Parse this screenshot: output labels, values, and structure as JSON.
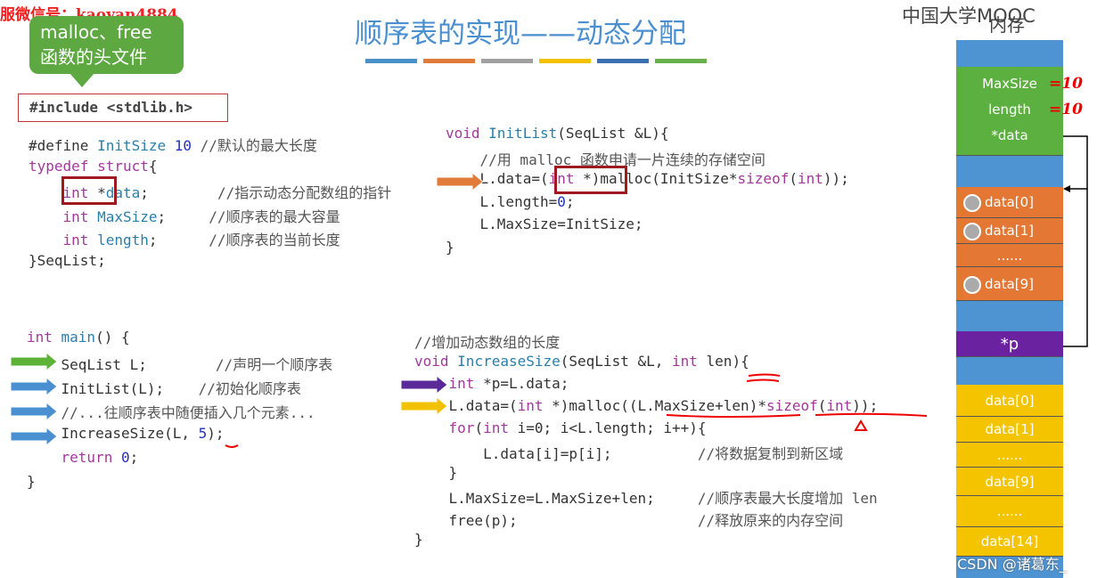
{
  "watermark": "服微信号：kaoyan4884",
  "title": "顺序表的实现——动态分配",
  "logo": "中国大学MOOC",
  "memory_label": "内存",
  "credit": "CSDN @诸葛东_",
  "callout": {
    "line1": "malloc、free",
    "line2": "函数的头文件"
  },
  "include": "#include <stdlib.h>",
  "title_bar_colors": [
    "#4a90c8",
    "#e07b39",
    "#a0a0a0",
    "#f2c200",
    "#3a6fb0",
    "#6ab04c"
  ],
  "code_struct": [
    [
      [
        "#define ",
        ""
      ],
      [
        "InitSize ",
        "id"
      ],
      [
        "10",
        "num"
      ],
      [
        " //默认的最大长度",
        "cm"
      ]
    ],
    [
      [
        "typedef struct",
        "kw"
      ],
      [
        "{",
        ""
      ]
    ],
    [
      [
        "    int ",
        "kw"
      ],
      [
        "*",
        ""
      ],
      [
        "data",
        "id"
      ],
      [
        ";        ",
        ""
      ],
      [
        "//指示动态分配数组的指针",
        "cm"
      ]
    ],
    [
      [
        "    int ",
        "kw"
      ],
      [
        "MaxSize",
        "id"
      ],
      [
        ";     ",
        ""
      ],
      [
        "//顺序表的最大容量",
        "cm"
      ]
    ],
    [
      [
        "    int ",
        "kw"
      ],
      [
        "length",
        "id"
      ],
      [
        ";      ",
        ""
      ],
      [
        "//顺序表的当前长度",
        "cm"
      ]
    ],
    [
      [
        "}SeqList;",
        ""
      ]
    ]
  ],
  "code_init": [
    [
      [
        "void ",
        "kw"
      ],
      [
        "InitList",
        "id"
      ],
      [
        "(SeqList &L){",
        ""
      ]
    ],
    [
      [
        "    //用 malloc 函数申请一片连续的存储空间",
        "cm"
      ]
    ],
    [
      [
        "    L.data=(",
        ""
      ],
      [
        "int",
        "kw"
      ],
      [
        " *)malloc(InitSize*",
        ""
      ],
      [
        "sizeof",
        "kw"
      ],
      [
        "(",
        ""
      ],
      [
        "int",
        "kw"
      ],
      [
        "));",
        ""
      ]
    ],
    [
      [
        "    L.length=",
        ""
      ],
      [
        "0",
        "num"
      ],
      [
        ";",
        ""
      ]
    ],
    [
      [
        "    L.MaxSize=InitSize;",
        ""
      ]
    ],
    [
      [
        "}",
        ""
      ]
    ]
  ],
  "code_main": [
    [
      [
        "int ",
        "kw"
      ],
      [
        "main",
        "id"
      ],
      [
        "() {",
        ""
      ]
    ],
    [
      [
        "    SeqList L;        ",
        ""
      ],
      [
        "//声明一个顺序表",
        "cm"
      ]
    ],
    [
      [
        "    InitList(L);    ",
        ""
      ],
      [
        "//初始化顺序表",
        "cm"
      ]
    ],
    [
      [
        "    //...往顺序表中随便插入几个元素...",
        "cm"
      ]
    ],
    [
      [
        "    IncreaseSize(L, ",
        ""
      ],
      [
        "5",
        "num"
      ],
      [
        ");",
        ""
      ]
    ],
    [
      [
        "    return ",
        "kw"
      ],
      [
        "0",
        "num"
      ],
      [
        ";",
        ""
      ]
    ],
    [
      [
        "}",
        ""
      ]
    ]
  ],
  "code_increase": [
    [
      [
        "//增加动态数组的长度",
        "cm"
      ]
    ],
    [
      [
        "void ",
        "kw"
      ],
      [
        "IncreaseSize",
        "id"
      ],
      [
        "(SeqList &L, ",
        ""
      ],
      [
        "int",
        "kw"
      ],
      [
        " len){",
        ""
      ]
    ],
    [
      [
        "    int ",
        "kw"
      ],
      [
        "*p=L.data;",
        ""
      ]
    ],
    [
      [
        "    L.data=(",
        ""
      ],
      [
        "int",
        "kw"
      ],
      [
        " *)malloc((L.MaxSize+len)*",
        ""
      ],
      [
        "sizeof",
        "kw"
      ],
      [
        "(",
        ""
      ],
      [
        "int",
        "kw"
      ],
      [
        "));",
        ""
      ]
    ],
    [
      [
        "    for",
        "kw"
      ],
      [
        "(",
        ""
      ],
      [
        "int",
        "kw"
      ],
      [
        " i=0; i<L.length; i++){",
        ""
      ]
    ],
    [
      [
        "        L.data[i]=p[i];          ",
        ""
      ],
      [
        "//将数据复制到新区域",
        "cm"
      ]
    ],
    [
      [
        "    }",
        ""
      ]
    ],
    [
      [
        "    L.MaxSize=L.MaxSize+len;     ",
        ""
      ],
      [
        "//顺序表最大长度增加 len",
        "cm"
      ]
    ],
    [
      [
        "    free(p);                     ",
        ""
      ],
      [
        "//释放原来的内存空间",
        "cm"
      ]
    ],
    [
      [
        "}",
        ""
      ]
    ]
  ],
  "arrow_colors": {
    "green": "#5cb338",
    "blue": "#4a90d0",
    "orange": "#e07b39",
    "purple": "#5b2a9a",
    "yellow": "#f2c200"
  },
  "memory": {
    "struct_fields": [
      "MaxSize",
      "length",
      "*data"
    ],
    "handwritten": [
      "=10",
      "=10"
    ],
    "old_cells": [
      "data[0]",
      "data[1]",
      "......",
      "data[9]"
    ],
    "pointer_p": "*p",
    "new_cells": [
      "data[0]",
      "data[1]",
      "......",
      "data[9]",
      "......",
      "data[14]"
    ],
    "colors": {
      "free": "#4e94d2",
      "struct": "#5cb040",
      "old": "#e37733",
      "pointer": "#6a22a0",
      "new": "#f5c400"
    }
  }
}
